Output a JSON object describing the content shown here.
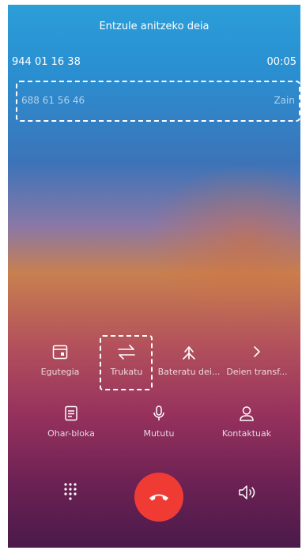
{
  "call": {
    "title": "Entzule anitzeko deia",
    "active": {
      "number": "944 01 16 38",
      "timer": "00:05"
    },
    "held": {
      "number": "688 61 56 46",
      "status": "Zain"
    }
  },
  "actions": [
    {
      "label": "Egutegia",
      "icon": "calendar-icon"
    },
    {
      "label": "Trukatu",
      "icon": "swap-icon"
    },
    {
      "label": "Bateratu dei...",
      "icon": "merge-icon"
    },
    {
      "label": "Deien transf...",
      "icon": "chevron-right-icon"
    },
    {
      "label": "Ohar-bloka",
      "icon": "notepad-icon"
    },
    {
      "label": "Mututu",
      "icon": "microphone-icon"
    },
    {
      "label": "Kontaktuak",
      "icon": "contacts-icon"
    }
  ],
  "bottom": {
    "dialpad_icon": "dialpad-icon",
    "end_call_icon": "end-call-icon",
    "speaker_icon": "speaker-icon"
  },
  "colors": {
    "end_call": "#f03b35",
    "text": "#ffffff"
  }
}
